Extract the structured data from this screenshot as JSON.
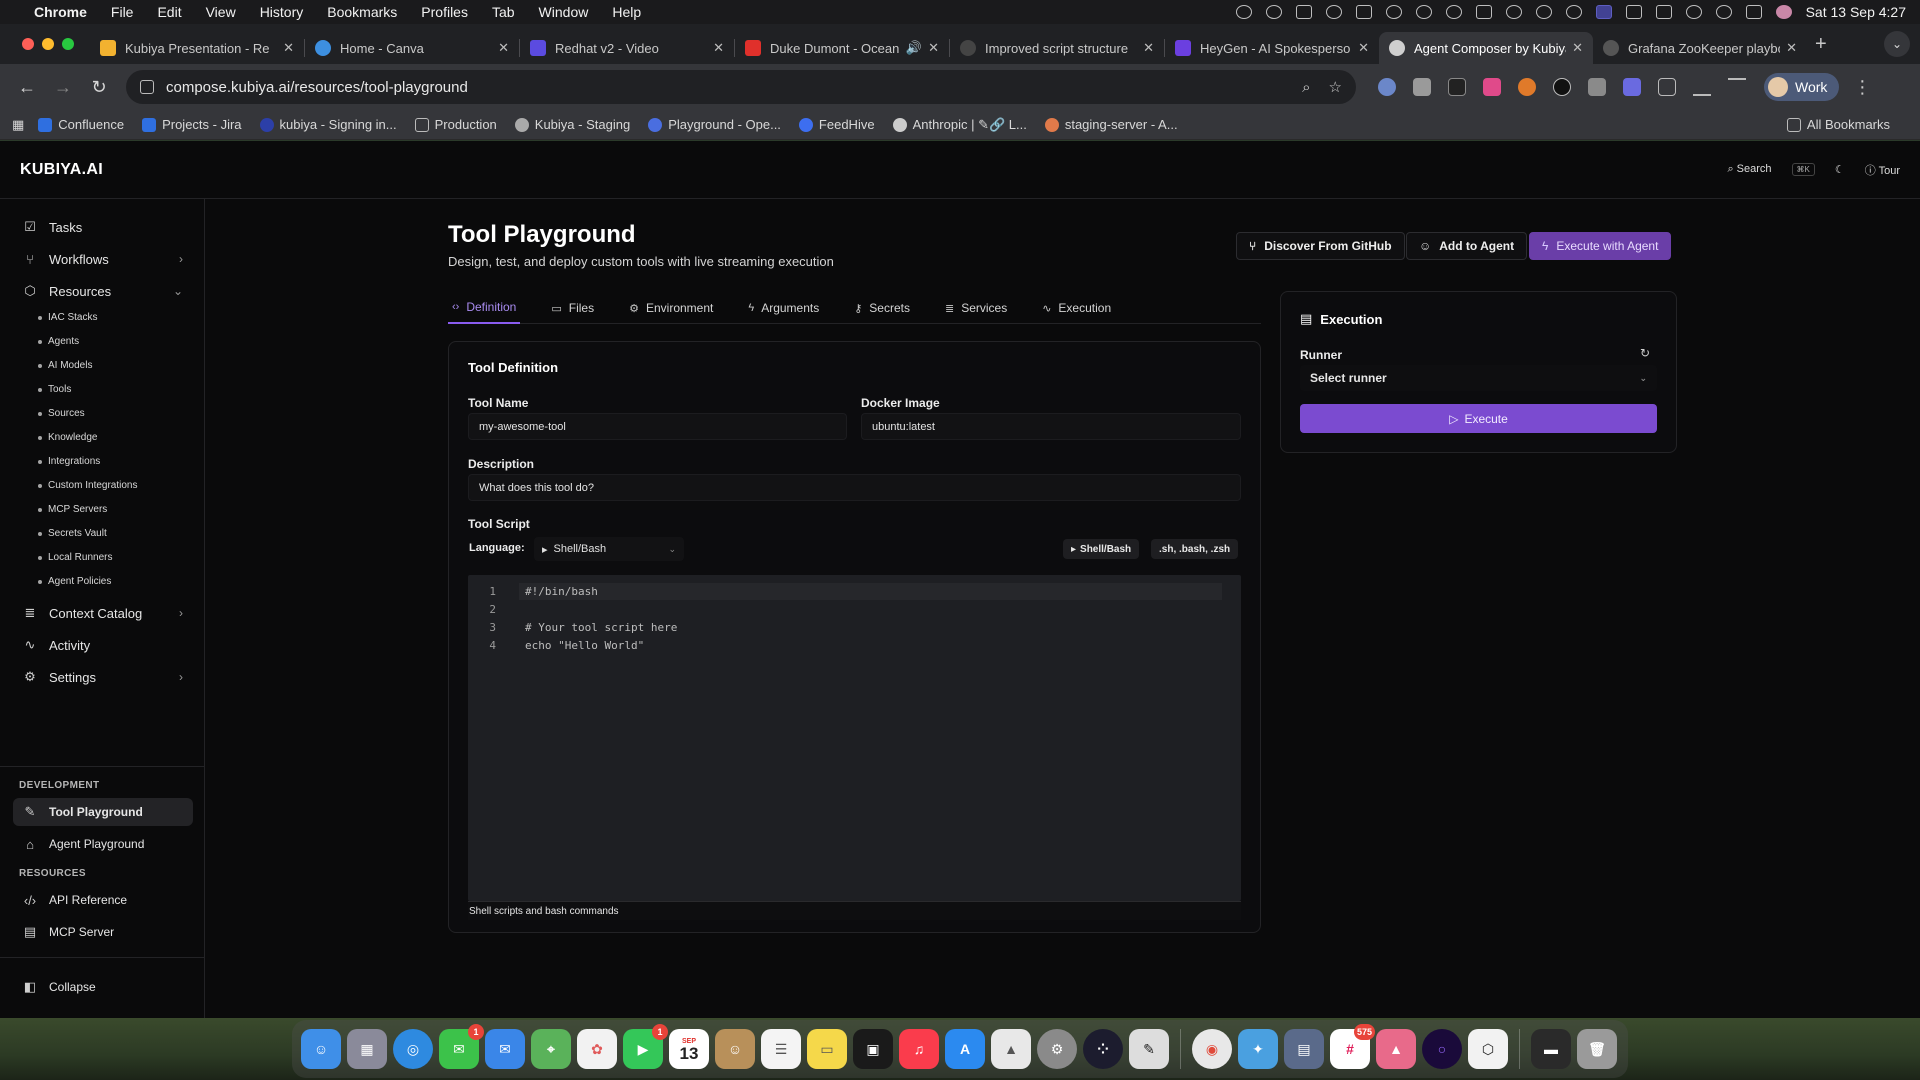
{
  "menubar": {
    "app": "Chrome",
    "items": [
      "File",
      "Edit",
      "View",
      "History",
      "Bookmarks",
      "Profiles",
      "Tab",
      "Window",
      "Help"
    ],
    "datetime": "Sat 13 Sep  4:27"
  },
  "tabs": [
    {
      "title": "Kubiya Presentation - Re",
      "color": "#f2b230"
    },
    {
      "title": "Home - Canva",
      "color": "#3d8fe0"
    },
    {
      "title": "Redhat v2 - Video",
      "color": "#5b4be0"
    },
    {
      "title": "Duke Dumont - Ocean",
      "color": "#e0302b"
    },
    {
      "title": "Improved script structure",
      "color": "#444444"
    },
    {
      "title": "HeyGen - AI Spokesperso",
      "color": "#6b3fe0"
    },
    {
      "title": "Agent Composer by Kubiya",
      "color": "#cfcfcf"
    },
    {
      "title": "Grafana ZooKeeper playbo",
      "color": "#555555"
    }
  ],
  "browser": {
    "url": "compose.kubiya.ai/resources/tool-playground",
    "profile": "Work"
  },
  "bookmarks": [
    {
      "label": "Confluence",
      "color": "#2f6fe0"
    },
    {
      "label": "Projects - Jira",
      "color": "#2f6fe0"
    },
    {
      "label": "kubiya - Signing in...",
      "color": "#2c3fa8"
    },
    {
      "label": "Production",
      "color": "#888888"
    },
    {
      "label": "Kubiya - Staging",
      "color": "#aaaaaa"
    },
    {
      "label": "Playground - Ope...",
      "color": "#4a6ee0"
    },
    {
      "label": "FeedHive",
      "color": "#3d6ef0"
    },
    {
      "label": "Anthropic | ✎🔗 L...",
      "color": "#cccccc"
    },
    {
      "label": "staging-server - A...",
      "color": "#e07a4a"
    }
  ],
  "all_bookmarks": "All Bookmarks",
  "app": {
    "logo": "KUBIYA.AI",
    "header": {
      "search": "Search",
      "search_kbd": "⌘K",
      "tour": "Tour"
    },
    "sidebar": {
      "main": [
        {
          "label": "Tasks"
        },
        {
          "label": "Workflows"
        },
        {
          "label": "Resources"
        }
      ],
      "resources_sub": [
        "IAC Stacks",
        "Agents",
        "AI Models",
        "Tools",
        "Sources",
        "Knowledge",
        "Integrations",
        "Custom Integrations",
        "MCP Servers",
        "Secrets Vault",
        "Local Runners",
        "Agent Policies"
      ],
      "main2": [
        {
          "label": "Context Catalog"
        },
        {
          "label": "Activity"
        },
        {
          "label": "Settings"
        }
      ],
      "development_label": "DEVELOPMENT",
      "development": [
        "Tool Playground",
        "Agent Playground"
      ],
      "resources_label": "RESOURCES",
      "resources": [
        "API Reference",
        "MCP Server"
      ],
      "collapse": "Collapse"
    },
    "page": {
      "title": "Tool Playground",
      "subtitle": "Design, test, and deploy custom tools with live streaming execution",
      "actions": {
        "discover": "Discover From GitHub",
        "add_to_agent": "Add to Agent",
        "execute_with_agent": "Execute with Agent"
      },
      "tabs": [
        "Definition",
        "Files",
        "Environment",
        "Arguments",
        "Secrets",
        "Services",
        "Execution"
      ]
    },
    "tool_definition": {
      "title": "Tool Definition",
      "tool_name_label": "Tool Name",
      "tool_name_value": "my-awesome-tool",
      "docker_image_label": "Docker Image",
      "docker_image_value": "ubuntu:latest",
      "description_label": "Description",
      "description_placeholder": "What does this tool do?",
      "script_label": "Tool Script",
      "language_label": "Language:",
      "language_value": "Shell/Bash",
      "chip_lang": "Shell/Bash",
      "chip_ext": ".sh, .bash, .zsh",
      "code_lines": [
        {
          "num": "1",
          "text": "#!/bin/bash"
        },
        {
          "num": "2",
          "text": ""
        },
        {
          "num": "3",
          "text": "# Your tool script here"
        },
        {
          "num": "4",
          "kw": "echo",
          "str": "\"Hello World\""
        }
      ],
      "editor_footer": "Shell scripts and bash commands"
    },
    "execution": {
      "title": "Execution",
      "runner_label": "Runner",
      "runner_placeholder": "Select runner",
      "execute_label": "Execute"
    }
  },
  "dock": {
    "badges": {
      "messages": "1",
      "facetime": "1",
      "slack": "575"
    },
    "calendar_month": "SEP",
    "calendar_day": "13"
  }
}
